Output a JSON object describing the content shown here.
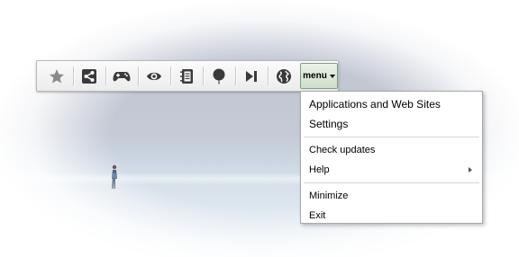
{
  "toolbar": {
    "buttons": [
      {
        "icon": "star-icon"
      },
      {
        "icon": "share-icon"
      },
      {
        "icon": "gamepad-icon"
      },
      {
        "icon": "eye-icon"
      },
      {
        "icon": "notebook-icon"
      },
      {
        "icon": "balloon-icon"
      },
      {
        "icon": "skip-forward-icon"
      },
      {
        "icon": "globe-icon"
      }
    ],
    "menu_label": "menu"
  },
  "menu": {
    "items": [
      {
        "label": "Applications and Web Sites"
      },
      {
        "label": "Settings"
      },
      {
        "label": "Check updates"
      },
      {
        "label": "Help",
        "has_submenu": true
      },
      {
        "label": "Minimize"
      },
      {
        "label": "Exit"
      }
    ]
  },
  "colors": {
    "menu_button_bg": "#d6e4d0",
    "menu_button_border": "#7d9f86",
    "icon_color": "#3a3a3a",
    "star_color": "#8a8a8a"
  }
}
